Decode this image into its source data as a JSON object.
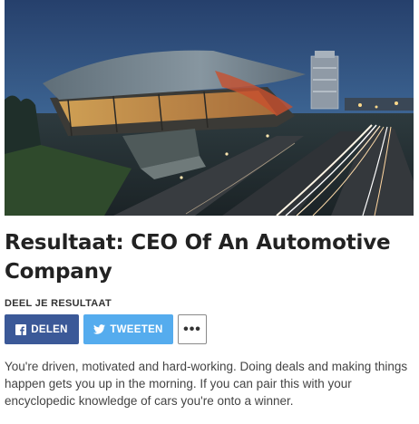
{
  "hero": {
    "image": "bmw-welt-building-at-dusk-with-highway-light-trails"
  },
  "result": {
    "title": "Resultaat: CEO Of An Automotive Company"
  },
  "share": {
    "heading": "DEEL JE RESULTAAT",
    "facebook_label": "DELEN",
    "facebook_icon": "facebook-icon",
    "twitter_label": "TWEETEN",
    "twitter_icon": "twitter-icon",
    "more_label": "•••",
    "facebook_color": "#3b5998",
    "twitter_color": "#55acee"
  },
  "description": "You're driven, motivated and hard-working. Doing deals and making things happen gets you up in the morning. If you can pair this with your encyclopedic knowledge of cars you're onto a winner."
}
